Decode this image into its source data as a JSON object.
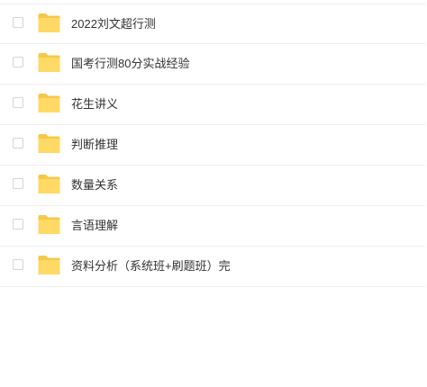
{
  "files": [
    {
      "name": "2022刘文超行测",
      "icon": "folder-icon"
    },
    {
      "name": "国考行测80分实战经验",
      "icon": "folder-icon"
    },
    {
      "name": "花生讲义",
      "icon": "folder-icon"
    },
    {
      "name": "判断推理",
      "icon": "folder-icon"
    },
    {
      "name": "数量关系",
      "icon": "folder-icon"
    },
    {
      "name": "言语理解",
      "icon": "folder-icon"
    },
    {
      "name": "资料分析（系统班+刷题班）完",
      "icon": "folder-icon"
    }
  ],
  "colors": {
    "folder_back": "#F7C748",
    "folder_front": "#FFD966",
    "row_border": "#EEEEEE",
    "text": "#333333"
  }
}
